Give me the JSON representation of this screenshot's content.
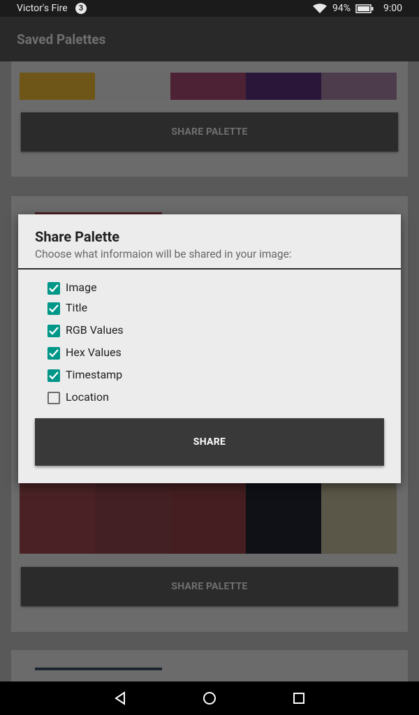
{
  "status_bar": {
    "device_name": "Victor's Fire",
    "notification_count": "3",
    "battery": "94%",
    "time": "9:00"
  },
  "app_bar": {
    "title": "Saved Palettes"
  },
  "cards": [
    {
      "swatches": [
        "#6d5618",
        "#6a6a6a",
        "#4d2235",
        "#291638",
        "#4d3d4c"
      ],
      "button": "SHARE PALETTE"
    },
    {
      "swatches": [
        "#4a2225",
        "#432024",
        "#441e20",
        "#0f1117",
        "#5a5748"
      ],
      "button": "SHARE PALETTE"
    }
  ],
  "dialog": {
    "title": "Share Palette",
    "subtitle": "Choose what informaion will be shared in your image:",
    "options": [
      {
        "label": "Image",
        "checked": true
      },
      {
        "label": "Title",
        "checked": true
      },
      {
        "label": "RGB Values",
        "checked": true
      },
      {
        "label": "Hex Values",
        "checked": true
      },
      {
        "label": "Timestamp",
        "checked": true
      },
      {
        "label": "Location",
        "checked": false
      }
    ],
    "share_button": "SHARE"
  },
  "colors": {
    "accent": "#009688",
    "dialog_bg": "#ececec",
    "scrim": "#595959"
  }
}
